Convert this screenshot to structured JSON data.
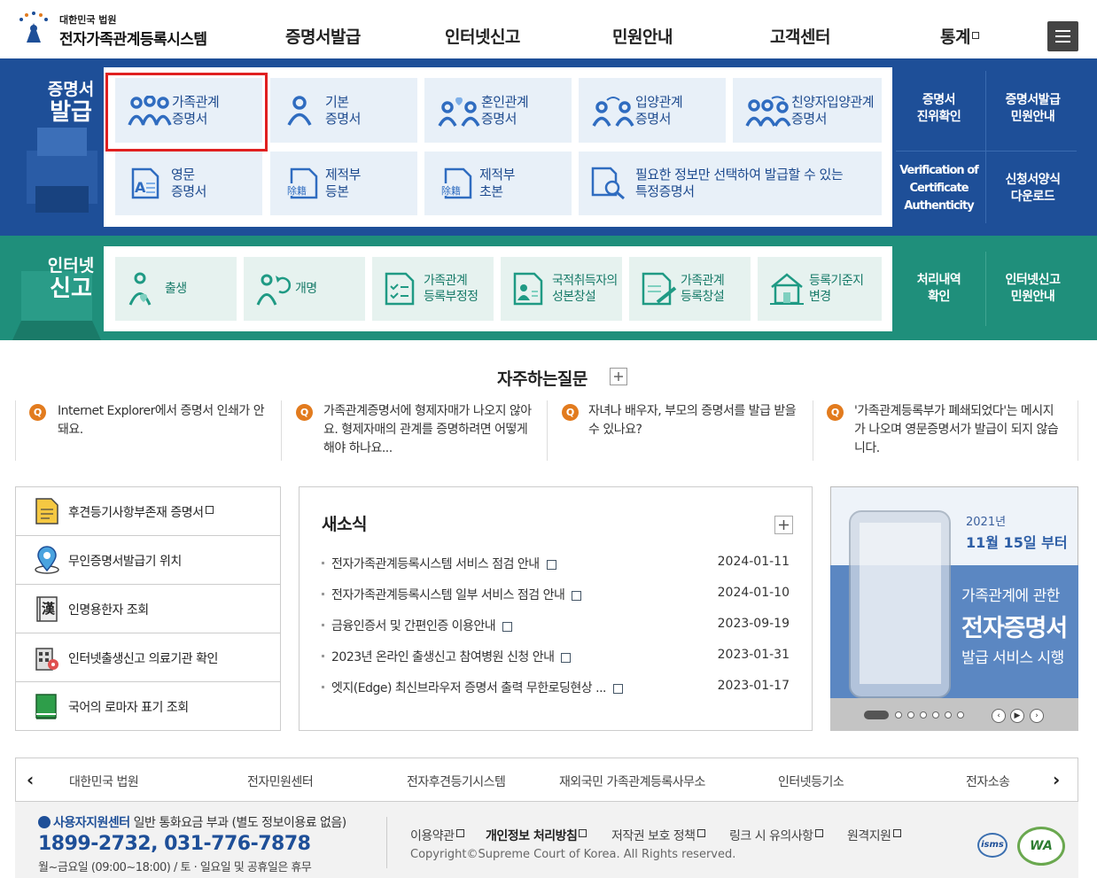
{
  "header": {
    "logo_sub": "대한민국 법원",
    "logo_main": "전자가족관계등록시스템",
    "nav": [
      "증명서발급",
      "인터넷신고",
      "민원안내",
      "고객센터",
      "통계"
    ]
  },
  "certificates": {
    "title_line1": "증명서",
    "title_line2": "발급",
    "tiles": [
      {
        "label1": "가족관계",
        "label2": "증명서",
        "icon": "family-icon"
      },
      {
        "label1": "기본",
        "label2": "증명서",
        "icon": "person-icon"
      },
      {
        "label1": "혼인관계",
        "label2": "증명서",
        "icon": "couple-heart-icon"
      },
      {
        "label1": "입양관계",
        "label2": "증명서",
        "icon": "adoption-icon"
      },
      {
        "label1": "친양자입양관계",
        "label2": "증명서",
        "icon": "family-adoption-icon"
      },
      {
        "label1": "영문",
        "label2": "증명서",
        "icon": "english-doc-icon"
      },
      {
        "label1": "제적부",
        "label2": "등본",
        "icon": "removed-register-icon"
      },
      {
        "label1": "제적부",
        "label2": "초본",
        "icon": "removed-register-icon"
      },
      {
        "label1": "필요한 정보만 선택하여 발급할 수 있는",
        "label2": "특정증명서",
        "icon": "search-doc-icon"
      }
    ],
    "side": [
      {
        "l1": "증명서",
        "l2": "진위확인"
      },
      {
        "l1": "증명서발급",
        "l2": "민원안내"
      },
      {
        "l1": "Verification of",
        "l2": "Certificate",
        "l3": "Authenticity"
      },
      {
        "l1": "신청서양식",
        "l2": "다운로드"
      }
    ]
  },
  "internet": {
    "title_line1": "인터넷",
    "title_line2": "신고",
    "tiles": [
      {
        "label1": "출생",
        "label2": "",
        "icon": "birth-icon"
      },
      {
        "label1": "개명",
        "label2": "",
        "icon": "rename-icon"
      },
      {
        "label1": "가족관계",
        "label2": "등록부정정",
        "icon": "checklist-doc-icon"
      },
      {
        "label1": "국적취득자의",
        "label2": "성본창설",
        "icon": "id-card-icon"
      },
      {
        "label1": "가족관계",
        "label2": "등록창설",
        "icon": "write-doc-icon"
      },
      {
        "label1": "등록기준지",
        "label2": "변경",
        "icon": "house-icon"
      }
    ],
    "side": [
      {
        "l1": "처리내역",
        "l2": "확인"
      },
      {
        "l1": "인터넷신고",
        "l2": "민원안내"
      }
    ]
  },
  "faq": {
    "title": "자주하는질문",
    "q_badge": "Q",
    "items": [
      "Internet Explorer에서 증명서 인쇄가 안돼요.",
      "가족관계증명서에 형제자매가 나오지 않아요. 형제자매의 관계를 증명하려면 어떻게 해야 하나요...",
      "자녀나 배우자, 부모의 증명서를 발급 받을 수 있나요?",
      "'가족관계등록부가 폐쇄되었다'는 메시지가 나오며 영문증명서가 발급이 되지 않습니다."
    ]
  },
  "quick": [
    {
      "label": "후견등기사항부존재 증명서",
      "icon": "certificate-doc-icon"
    },
    {
      "label": "무인증명서발급기 위치",
      "icon": "location-pin-icon"
    },
    {
      "label": "인명용한자 조회",
      "icon": "hanja-book-icon"
    },
    {
      "label": "인터넷출생신고 의료기관 확인",
      "icon": "hospital-icon"
    },
    {
      "label": "국어의 로마자 표기 조회",
      "icon": "green-book-icon"
    }
  ],
  "news": {
    "title": "새소식",
    "items": [
      {
        "title": "전자가족관계등록시스템 서비스 점검 안내",
        "date": "2024-01-11"
      },
      {
        "title": "전자가족관계등록시스템 일부 서비스 점검 안내",
        "date": "2024-01-10"
      },
      {
        "title": "금융인증서 및 간편인증 이용안내",
        "date": "2023-09-19"
      },
      {
        "title": "2023년 온라인 출생신고 참여병원 신청 안내",
        "date": "2023-01-31"
      },
      {
        "title": "엣지(Edge) 최신브라우저 증명서 출력 무한로딩현상 ...",
        "date": "2023-01-17"
      }
    ]
  },
  "banner": {
    "year": "2021년",
    "date": "11월 15일 부터",
    "line1": "가족관계에 관한",
    "line2": "전자증명서",
    "line3": "발급 서비스 시행"
  },
  "sites": [
    "대한민국 법원",
    "전자민원센터",
    "전자후견등기시스템",
    "재외국민 가족관계등록사무소",
    "인터넷등기소",
    "전자소송"
  ],
  "footer": {
    "support_title": "사용자지원센터",
    "support_note": "일반 통화요금 부과 (별도 정보이용료 없음)",
    "phone": "1899-2732, 031-776-7878",
    "hours": "월~금요일 (09:00~18:00) / 토 · 일요일 및 공휴일은 휴무",
    "links": [
      "이용약관",
      "개인정보 처리방침",
      "저작권 보호 정책",
      "링크 시 유의사항",
      "원격지원"
    ],
    "copyright": "Copyright©Supreme Court of Korea. All Rights reserved.",
    "badge1": "isms",
    "badge2": "WA"
  },
  "colors": {
    "cert_blue": "#1e4f98",
    "net_green": "#1f8f7b",
    "accent_orange": "#e27b1e",
    "highlight_red": "#e02020"
  }
}
